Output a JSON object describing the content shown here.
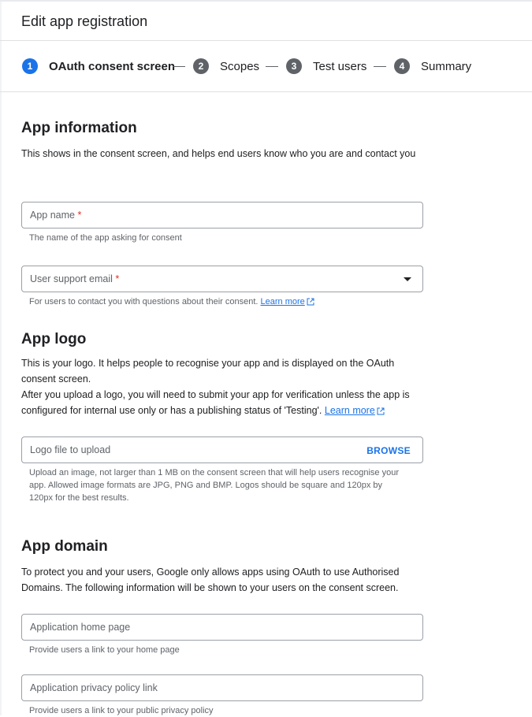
{
  "header": {
    "title": "Edit app registration"
  },
  "stepper": {
    "steps": [
      {
        "number": "1",
        "label": "OAuth consent screen"
      },
      {
        "number": "2",
        "label": "Scopes"
      },
      {
        "number": "3",
        "label": "Test users"
      },
      {
        "number": "4",
        "label": "Summary"
      }
    ]
  },
  "app_information": {
    "title": "App information",
    "description": "This shows in the consent screen, and helps end users know who you are and contact you",
    "app_name": {
      "placeholder": "App name",
      "required_mark": "*",
      "hint": "The name of the app asking for consent"
    },
    "support_email": {
      "placeholder": "User support email",
      "required_mark": "*",
      "hint": "For users to contact you with questions about their consent.",
      "learn_more": "Learn more"
    }
  },
  "app_logo": {
    "title": "App logo",
    "description_1": "This is your logo. It helps people to recognise your app and is displayed on the OAuth consent screen.",
    "description_2": "After you upload a logo, you will need to submit your app for verification unless the app is configured for internal use only or has a publishing status of 'Testing'.",
    "learn_more": "Learn more",
    "logo_field": {
      "placeholder": "Logo file to upload",
      "browse_label": "BROWSE"
    },
    "hint": "Upload an image, not larger than 1 MB on the consent screen that will help users recognise your app. Allowed image formats are JPG, PNG and BMP. Logos should be square and 120px by 120px for the best results."
  },
  "app_domain": {
    "title": "App domain",
    "description": "To protect you and your users, Google only allows apps using OAuth to use Authorised Domains. The following information will be shown to your users on the consent screen.",
    "home_page": {
      "placeholder": "Application home page",
      "hint": "Provide users a link to your home page"
    },
    "privacy_policy": {
      "placeholder": "Application privacy policy link",
      "hint": "Provide users a link to your public privacy policy"
    }
  },
  "colors": {
    "accent": "#1a73e8",
    "required": "#d93025",
    "step_inactive": "#5f6368",
    "border": "#9aa0a6"
  }
}
